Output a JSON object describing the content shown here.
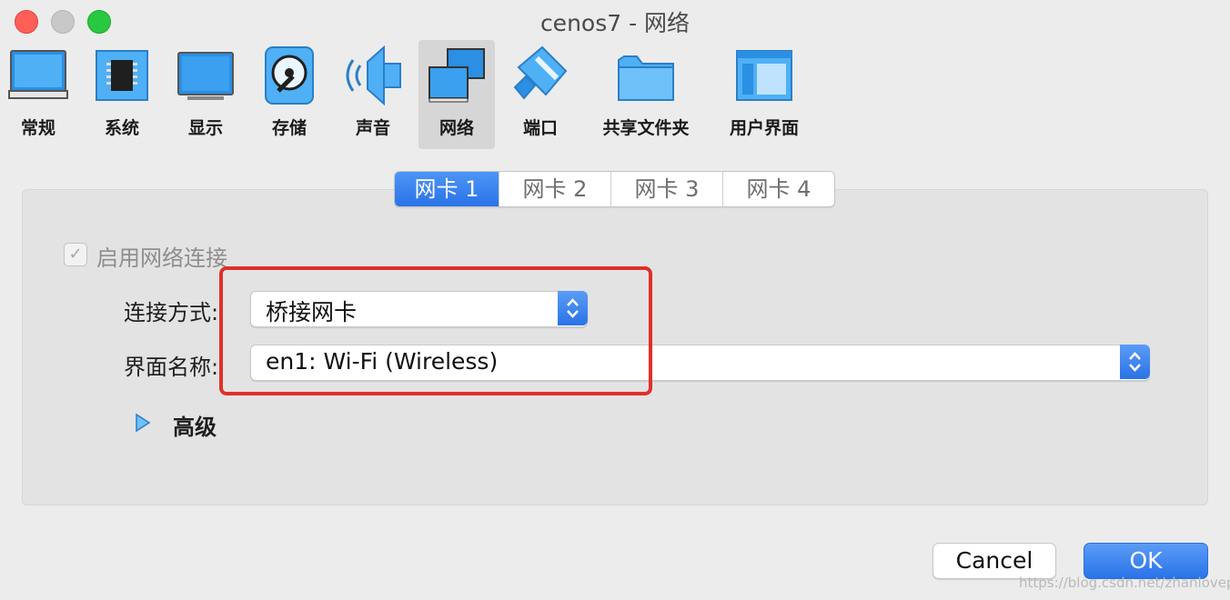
{
  "window": {
    "title": "cenos7 - 网络"
  },
  "toolbar": {
    "items": [
      {
        "label": "常规",
        "icon": "general-monitor-icon"
      },
      {
        "label": "系统",
        "icon": "system-chip-icon"
      },
      {
        "label": "显示",
        "icon": "display-monitor-icon"
      },
      {
        "label": "存储",
        "icon": "storage-disk-icon"
      },
      {
        "label": "声音",
        "icon": "audio-speaker-icon"
      },
      {
        "label": "网络",
        "icon": "network-icon"
      },
      {
        "label": "端口",
        "icon": "ports-connector-icon"
      },
      {
        "label": "共享文件夹",
        "icon": "shared-folder-icon"
      },
      {
        "label": "用户界面",
        "icon": "user-interface-icon"
      }
    ],
    "active": "网络"
  },
  "tabs": [
    {
      "label": "网卡 1",
      "active": true
    },
    {
      "label": "网卡 2",
      "active": false
    },
    {
      "label": "网卡 3",
      "active": false
    },
    {
      "label": "网卡 4",
      "active": false
    }
  ],
  "adapter": {
    "enable_label": "启用网络连接",
    "enabled": true,
    "attached_label": "连接方式:",
    "attached_value": "桥接网卡",
    "name_label": "界面名称:",
    "name_value": "en1: Wi-Fi (Wireless)",
    "advanced_label": "高级"
  },
  "buttons": {
    "cancel": "Cancel",
    "ok": "OK"
  },
  "watermark": "https://blog.csdn.net/zhanlovepei",
  "colors": {
    "accent": "#2a73e8",
    "highlight": "#e0302a"
  }
}
